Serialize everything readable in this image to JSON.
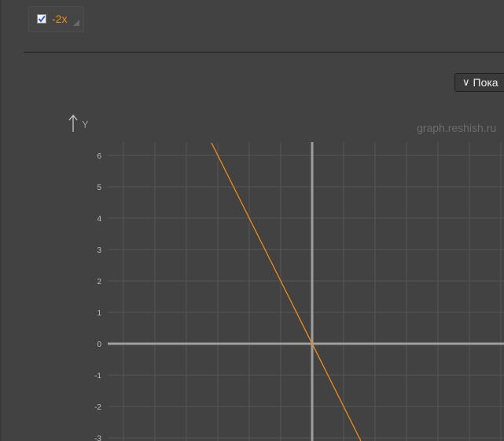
{
  "function_item": {
    "expression": "-2x",
    "checked": true,
    "color": "#f08a1a"
  },
  "toolbar": {
    "show_button_icon": "∨",
    "show_button_label": "Пока"
  },
  "watermark": "graph.reshish.ru",
  "colors": {
    "background": "#424242",
    "grid": "#555555",
    "axis": "#9e9e9e",
    "tick_label": "#bdbdbd",
    "line": "#f08a1a"
  },
  "chart_data": {
    "type": "line",
    "title": "",
    "xlabel": "",
    "ylabel": "Y",
    "xlim": [
      -6.5,
      6.0
    ],
    "ylim": [
      -3.3,
      6.5
    ],
    "grid": true,
    "y_ticks": [
      6,
      5,
      4,
      3,
      2,
      1,
      0,
      -1,
      -2,
      -3
    ],
    "series": [
      {
        "name": "-2x",
        "color": "#f08a1a",
        "x": [
          -3.2,
          1.55
        ],
        "y": [
          6.4,
          -3.1
        ]
      }
    ]
  }
}
